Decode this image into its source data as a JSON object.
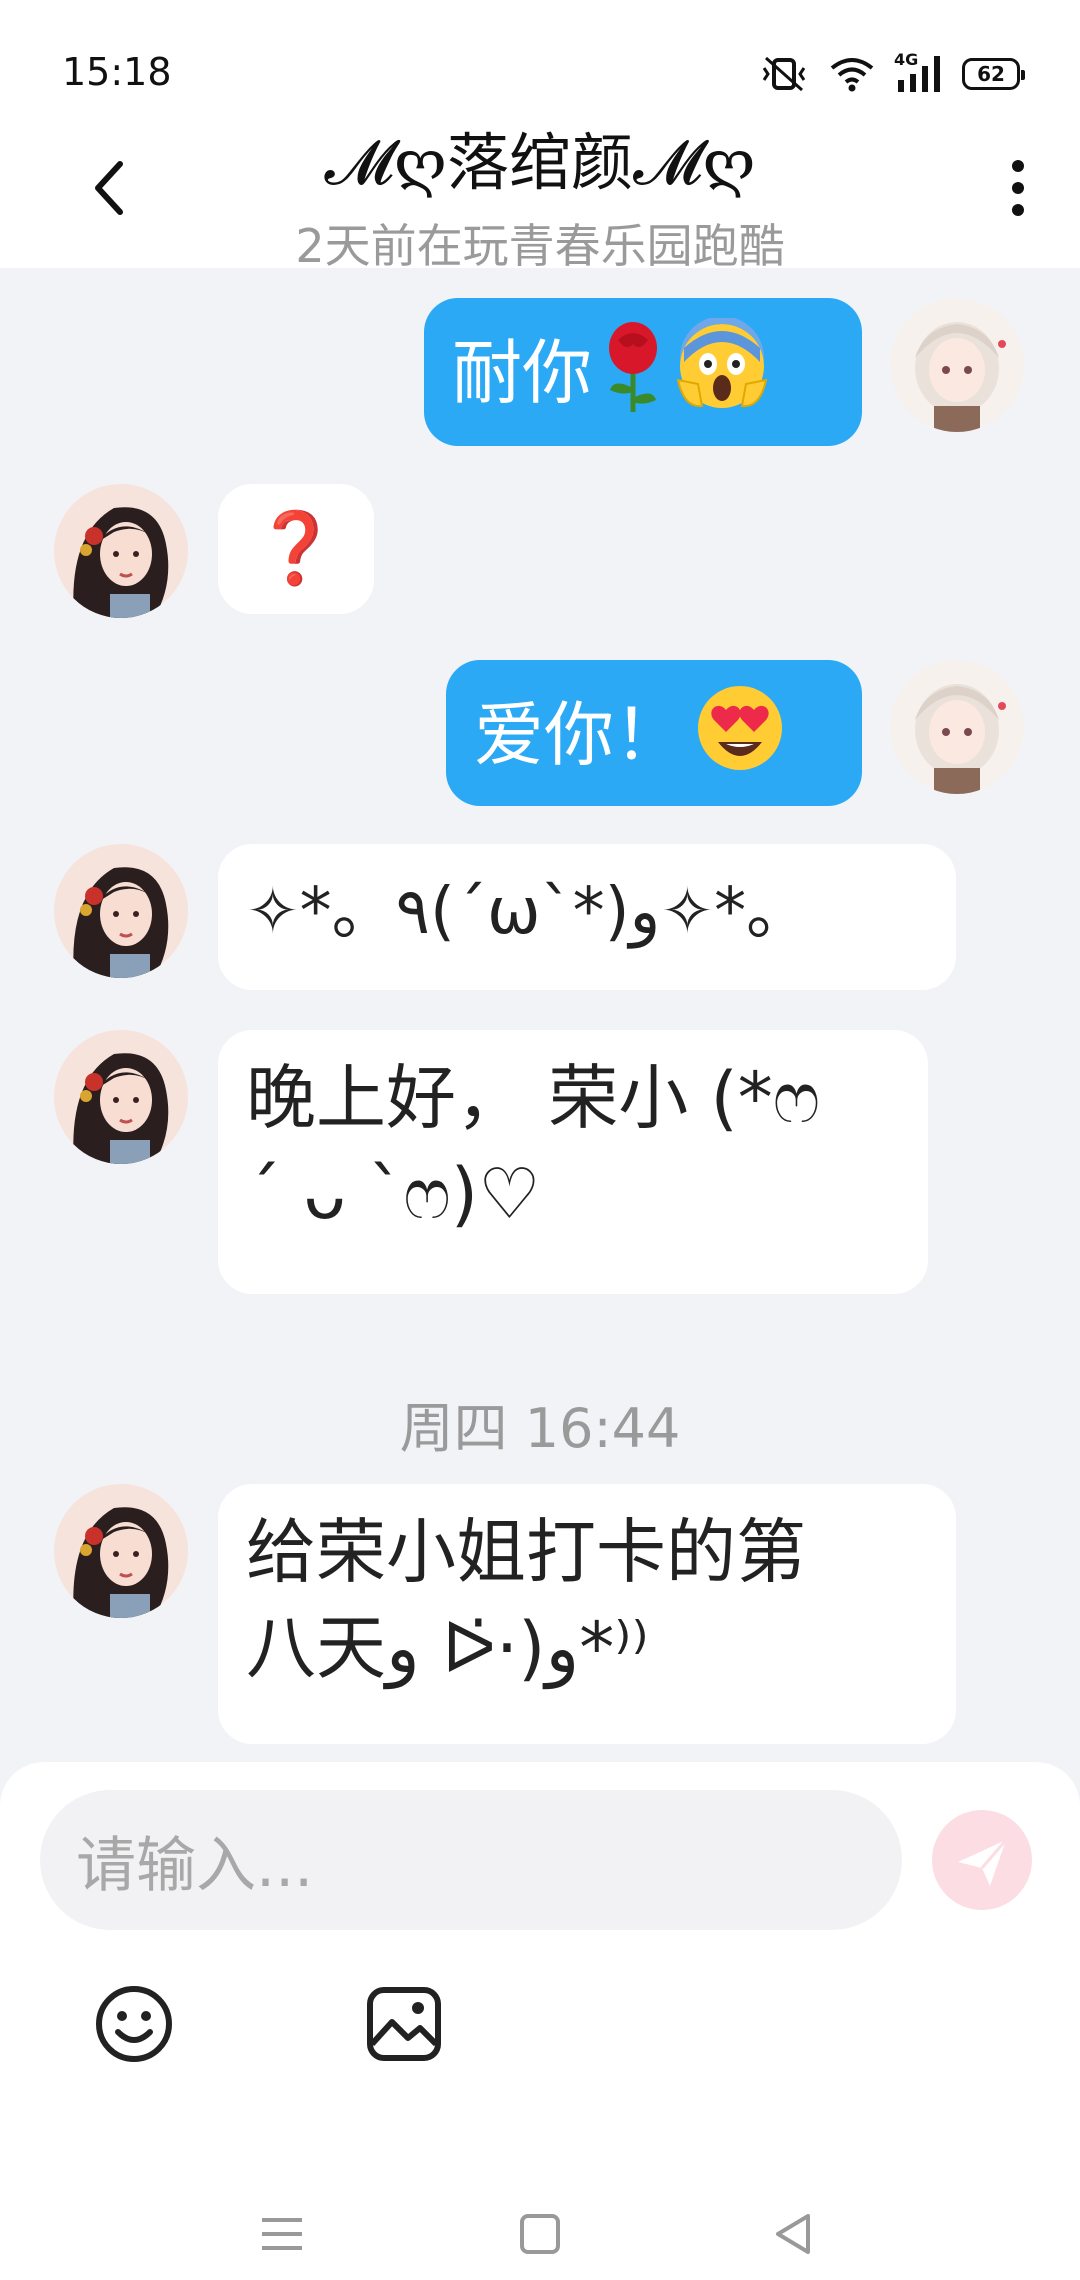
{
  "status_bar": {
    "time": "15:18",
    "network": "4G",
    "battery": "62"
  },
  "header": {
    "name": "𝓜ღ落绾颜𝓜ღ",
    "subtitle": "2天前在玩青春乐园跑酷"
  },
  "messages": [
    {
      "side": "out",
      "text": "耐你",
      "emojis": [
        "rose-emoji",
        "scream-emoji"
      ]
    },
    {
      "side": "in",
      "text": "❓"
    },
    {
      "side": "out",
      "text": "爱你！",
      "emojis": [
        "heart-eyes-emoji"
      ]
    },
    {
      "side": "in",
      "text": "✧*。٩(ˊωˋ*)و✧*。"
    },
    {
      "side": "in",
      "line1": "晚上好， 荣小 (*ෆ",
      "line2": "´ ᴗ `ෆ)♡"
    },
    {
      "side": "in",
      "line1": "给荣小姐打卡的第",
      "line2": "八天و ᐅ̇·)و*⁾⁾"
    }
  ],
  "time_separator": "周四 16:44",
  "composer": {
    "placeholder": "请输入..."
  },
  "icons": {
    "back": "chevron-left-icon",
    "more": "more-vertical-icon",
    "send": "send-icon",
    "emoji": "emoji-icon",
    "image": "image-icon"
  },
  "colors": {
    "accent_bubble": "#2ba9f5",
    "background": "#f2f3f7",
    "send_button": "#fbdde3"
  }
}
